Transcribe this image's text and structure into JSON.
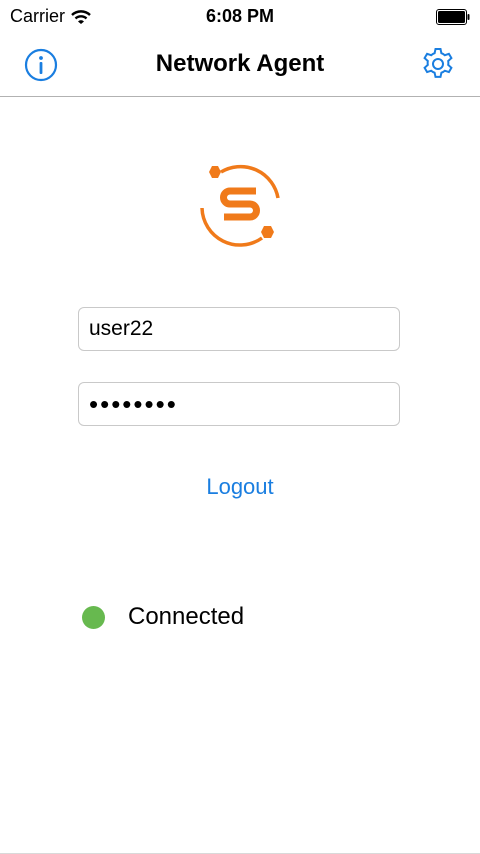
{
  "status_bar": {
    "carrier": "Carrier",
    "time": "6:08 PM",
    "icons": [
      "wifi-icon",
      "battery-icon"
    ]
  },
  "nav": {
    "title": "Network Agent",
    "left_icon": "info-icon",
    "right_icon": "gear-icon"
  },
  "login": {
    "username_value": "user22",
    "password_value": "password",
    "logout_label": "Logout"
  },
  "connection": {
    "status_text": "Connected",
    "status_color": "#67b94f"
  },
  "colors": {
    "accent": "#1a7ee0",
    "logo": "#f07a1a",
    "divider": "#b2b2b2"
  },
  "logo": {
    "letter": "S"
  }
}
